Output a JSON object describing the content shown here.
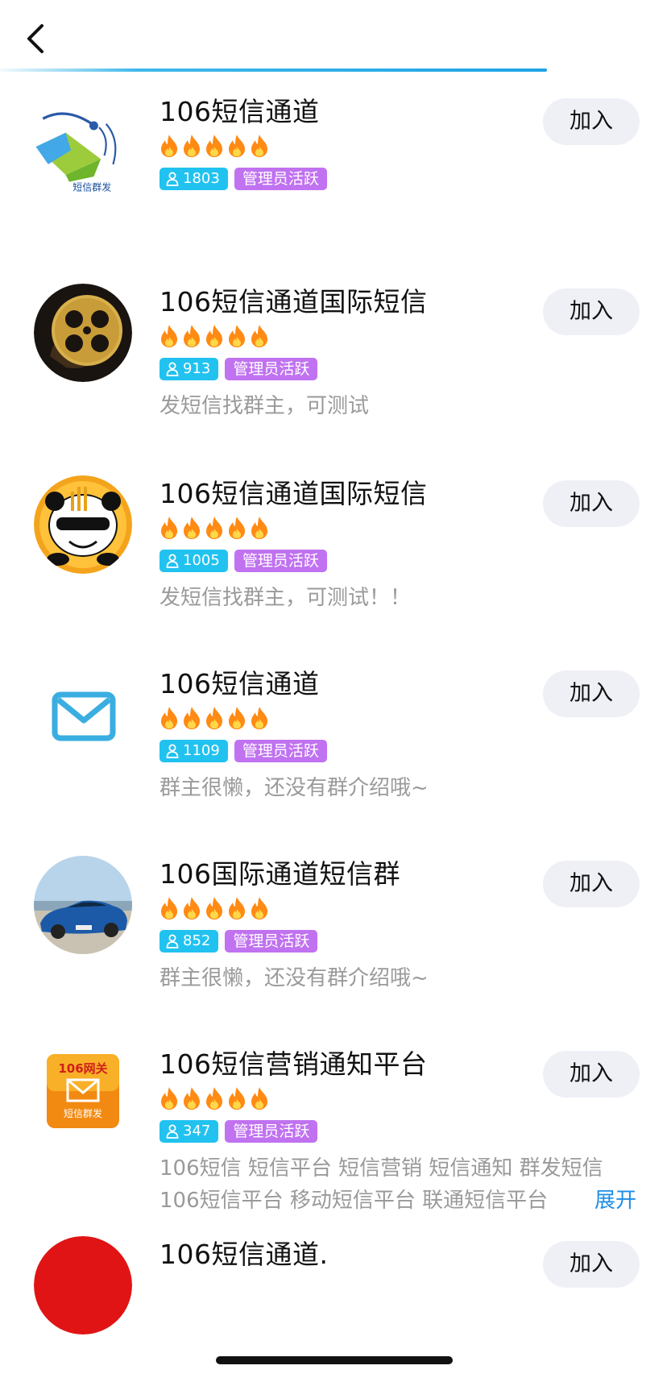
{
  "nav": {
    "back_label": "‹"
  },
  "progress": {
    "fraction": 0.82
  },
  "groups": [
    {
      "name": "106短信通道",
      "rating": 5,
      "members": "1803",
      "badge": "管理员活跃",
      "desc": "",
      "desc2": "",
      "join": "加入",
      "avatar": "sms-bulk-logo"
    },
    {
      "name": "106短信通道国际短信",
      "rating": 5,
      "members": "913",
      "badge": "管理员活跃",
      "desc": "发短信找群主，可测试",
      "desc2": "",
      "join": "加入",
      "avatar": "film-reel"
    },
    {
      "name": "106短信通道国际短信",
      "rating": 5,
      "members": "1005",
      "badge": "管理员活跃",
      "desc": "发短信找群主，可测试！！",
      "desc2": "",
      "join": "加入",
      "avatar": "panda"
    },
    {
      "name": "106短信通道",
      "rating": 5,
      "members": "1109",
      "badge": "管理员活跃",
      "desc": "群主很懒，还没有群介绍哦~",
      "desc2": "",
      "join": "加入",
      "avatar": "envelope"
    },
    {
      "name": "106国际通道短信群",
      "rating": 5,
      "members": "852",
      "badge": "管理员活跃",
      "desc": "群主很懒，还没有群介绍哦~",
      "desc2": "",
      "join": "加入",
      "avatar": "blue-car"
    },
    {
      "name": "106短信营销通知平台",
      "rating": 5,
      "members": "347",
      "badge": "管理员活跃",
      "desc": "106短信 短信平台 短信营销 短信通知 群发短信",
      "desc2": "106短信平台 移动短信平台 联通短信平台",
      "join": "加入",
      "avatar": "106-gateway-logo",
      "expand": "展开",
      "avatar_text": "106网关",
      "avatar_caption": "短信群发"
    },
    {
      "name": "106短信通道.",
      "rating": 5,
      "members": "",
      "badge": "",
      "desc": "",
      "desc2": "",
      "join": "加入",
      "avatar": "red-circle"
    }
  ],
  "first_avatar_caption": "短信群发",
  "colors": {
    "accent_blue": "#1ea4e6",
    "member_badge": "#21c2f0",
    "admin_badge": "#c072f0",
    "join_button_bg": "#eef0f6",
    "expand_link": "#1e8ee8",
    "flame_orange": "#ff8a14"
  }
}
